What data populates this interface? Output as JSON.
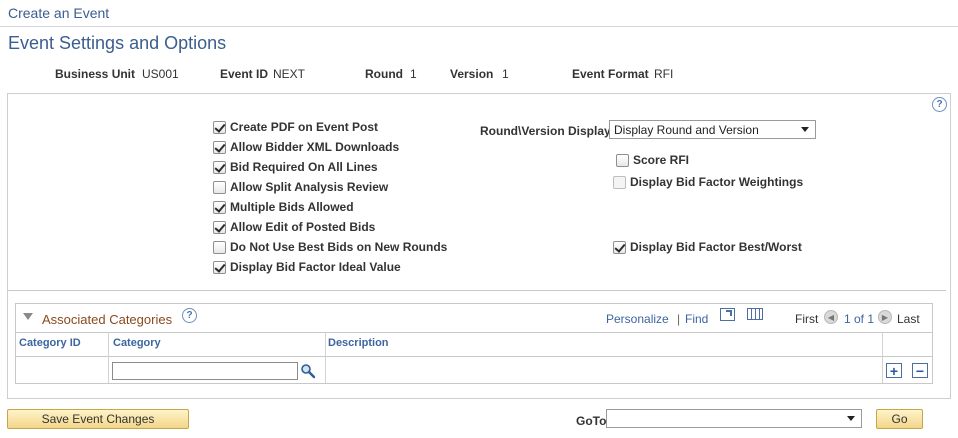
{
  "breadcrumb": "Create an Event",
  "page_title": "Event Settings and Options",
  "header": {
    "business_unit_label": "Business Unit",
    "business_unit_value": "US001",
    "event_id_label": "Event ID",
    "event_id_value": "NEXT",
    "round_label": "Round",
    "round_value": "1",
    "version_label": "Version",
    "version_value": "1",
    "event_format_label": "Event Format",
    "event_format_value": "RFI"
  },
  "help_glyph": "?",
  "options_left": [
    {
      "label": "Create PDF on Event Post",
      "checked": true
    },
    {
      "label": "Allow Bidder XML Downloads",
      "checked": true
    },
    {
      "label": "Bid Required On All Lines",
      "checked": true
    },
    {
      "label": "Allow Split Analysis Review",
      "checked": false
    },
    {
      "label": "Multiple Bids Allowed",
      "checked": true
    },
    {
      "label": "Allow Edit of Posted Bids",
      "checked": true
    },
    {
      "label": "Do Not Use Best Bids on New Rounds",
      "checked": false
    },
    {
      "label": "Display Bid Factor Ideal Value",
      "checked": true
    }
  ],
  "round_version_display": {
    "label": "Round\\Version Display",
    "value": "Display Round and Version"
  },
  "options_right": {
    "score_rfi": {
      "label": "Score RFI",
      "checked": false
    },
    "display_weightings": {
      "label": "Display Bid Factor Weightings",
      "checked": false,
      "disabled": true
    },
    "display_best_worst": {
      "label": "Display Bid Factor Best/Worst",
      "checked": true
    }
  },
  "grid": {
    "title": "Associated Categories",
    "personalize": "Personalize",
    "separator": "|",
    "find": "Find",
    "first": "First",
    "count": "1 of 1",
    "last": "Last",
    "columns": [
      "Category ID",
      "Category",
      "Description"
    ],
    "category_value": "",
    "add_glyph": "+",
    "remove_glyph": "−"
  },
  "footer": {
    "save_label": "Save Event Changes",
    "goto_label": "GoTo",
    "goto_value": "",
    "go_label": "Go"
  },
  "colors": {
    "title_blue": "#3b5d8f",
    "link_blue": "#3d65a0",
    "grid_title": "#8a4a1e",
    "button_yellow": "#f2d58a"
  }
}
